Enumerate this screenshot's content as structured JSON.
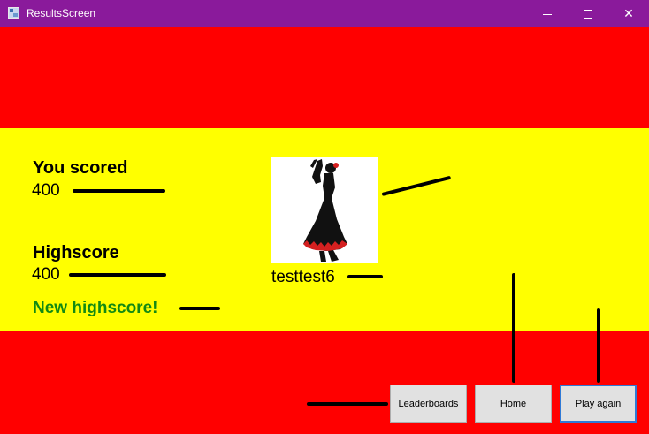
{
  "window": {
    "title": "ResultsScreen",
    "minimize_icon": "minimize-icon",
    "maximize_icon": "maximize-icon",
    "close_label": "✕"
  },
  "colors": {
    "title_bar": "#8a1a9b",
    "flag_red": "#ff0000",
    "flag_yellow": "#ffff00",
    "highscore_text": "#138a13",
    "focused_button_border": "#2f7ad6"
  },
  "results": {
    "score_label": "You scored",
    "score_value": "400",
    "highscore_label": "Highscore",
    "highscore_value": "400",
    "new_highscore_text": "New highscore!"
  },
  "player": {
    "avatar_icon": "flamenco-dancer-icon",
    "username": "testtest6"
  },
  "buttons": {
    "leaderboards": "Leaderboards",
    "home": "Home",
    "play_again": "Play again"
  }
}
